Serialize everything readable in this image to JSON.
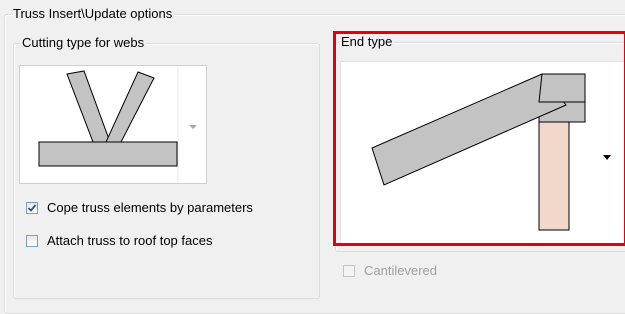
{
  "main_group": {
    "title": "Truss Insert\\Update options"
  },
  "cutting_group": {
    "title": "Cutting type for webs"
  },
  "end_type_group": {
    "title": "End type"
  },
  "checkboxes": {
    "cope": {
      "label": "Cope truss elements by parameters",
      "checked": true
    },
    "attach": {
      "label": "Attach truss to roof top faces",
      "checked": false
    },
    "cantilevered": {
      "label": "Cantilevered",
      "checked": false,
      "disabled": true
    }
  },
  "colors": {
    "highlight": "#e0000f",
    "member_fill": "#c3c3c3",
    "post_fill": "#f2d7cb"
  },
  "icons": [
    "web-cutting-preview-icon",
    "end-type-preview-icon",
    "dropdown-arrow-icon",
    "checkmark-icon"
  ]
}
